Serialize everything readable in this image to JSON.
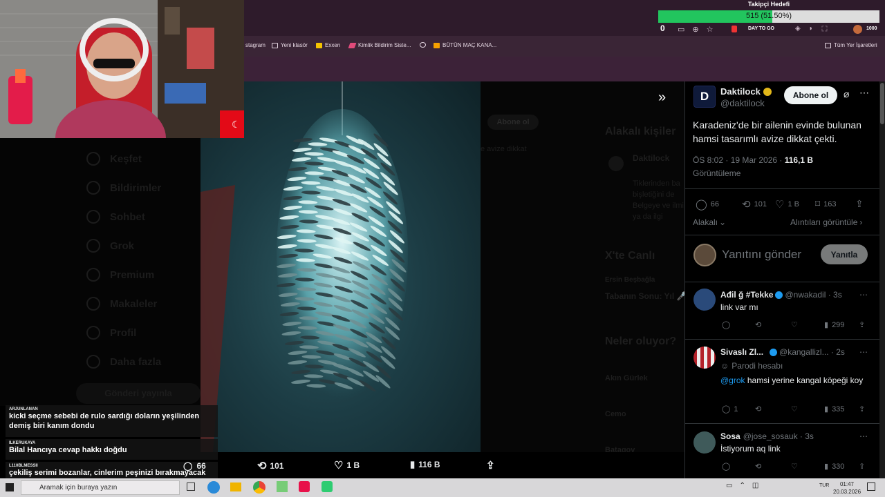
{
  "follower_goal": {
    "title": "Takipçi Hedefi",
    "progress_text": "515 (51.50%)",
    "progress": 0.515
  },
  "browser": {
    "badge_count": "0",
    "toolbar_mini_text": "1000",
    "tab_mini_text": "DAY TO GO",
    "bookmarks": [
      "stagram",
      "Yeni klasör",
      "Exxen",
      "Kimlik Bildirim Siste...",
      "BÜTÜN MAÇ KANA...",
      "Tüm Yer İşaretleri"
    ]
  },
  "background_sidebar": [
    "Keşfet",
    "Bildirimler",
    "Sohbet",
    "Grok",
    "Premium",
    "Makaleler",
    "Profil",
    "Daha fazla"
  ],
  "background_post_button": "Gönderi yayınla",
  "background_right": {
    "follow": "Abone ol",
    "snippet": "e avize dikkat",
    "relevant": "Alakalı kişiler",
    "name": "Daktilock",
    "bio": [
      "Tiklerinden ba",
      "bişletiğini de",
      "Belgeye ve ilmi",
      "ya da ilgi"
    ],
    "live": "X'te Canlı",
    "live_item": "Ersin Beşbağla",
    "live_sub": "Tabanın Sonu: Yıl 🎤",
    "whats_on": "Neler oluyor?",
    "trend1": "Akın Gürlek",
    "trend2": "Cemo",
    "trend3": "Batagov"
  },
  "media_actions": {
    "retweets": "101",
    "likes": "1 B",
    "views": "116 B"
  },
  "tweet": {
    "author": "Daktilock",
    "handle": "@daktilock",
    "follow_label": "Abone ol",
    "text": "Karadeniz'de bir ailenin evinde bulunan hamsi tasarımlı avize dikkat çekti.",
    "time": "ÖS 8:02 · 19 Mar 2026 · ",
    "views_count": "116,1 B",
    "views_label": "Görüntüleme",
    "stats": {
      "replies": "66",
      "retweets": "101",
      "likes": "1 B",
      "bookmarks": "163"
    },
    "sort_label": "Alakalı",
    "quotes_label": "Alıntıları görüntüle",
    "reply_placeholder": "Yanıtını gönder",
    "reply_button": "Yanıtla"
  },
  "replies": [
    {
      "name": "Ađil ğ #Tekke",
      "handle": "@nwakadil · 3s",
      "text": "link var mı",
      "views": "299",
      "replies": "",
      "parody": ""
    },
    {
      "name": "Sivaslı Zl...",
      "handle": "@kangallizl... · 2s",
      "parody": "Parodi hesabı",
      "mention": "@grok",
      "text": " hamsi yerine kangal köpeği koy",
      "replies": "1",
      "views": "335"
    },
    {
      "name": "Sosa",
      "handle": "@jose_sosauk · 3s",
      "text": "İstiyorum aq link",
      "views": "330",
      "replies": "",
      "parody": ""
    }
  ],
  "chat": [
    {
      "user": "ARJUNLANAN",
      "text": "kicki seçme sebebi de rulo sardığı doların yeşilinden demiş biri kanım dondu",
      "color": "#ff4b4b"
    },
    {
      "user": "ILKERUKAYA",
      "text": "Bilal Hancıya cevap hakkı doğdu",
      "color": "#d8d8d8"
    },
    {
      "user": "L110BLMESSII",
      "text": "çekiliş serimi bozanlar, cinlerim peşinizi bırakmayacak haberiniz olsun...",
      "color": "#ffc233"
    }
  ],
  "chat_count": "66",
  "taskbar": {
    "search": "Aramak için buraya yazın",
    "lang": "TUR",
    "time": "01:47",
    "date": "20.03.2026"
  },
  "colors": {
    "accent": "#1d9bf0",
    "verified_gold": "#e2b719",
    "progress_green": "#22c55e"
  }
}
